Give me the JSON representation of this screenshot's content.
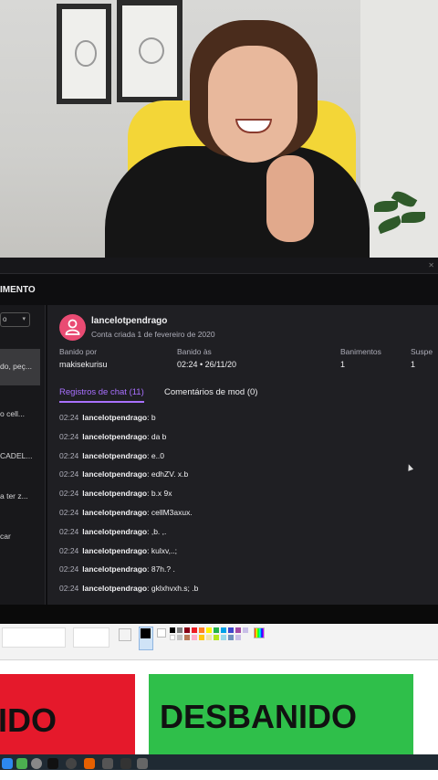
{
  "moderation": {
    "section_title": "IMENTO",
    "filter_value": "o",
    "sidebar_items": [
      "do, peç...",
      "o cell...",
      "CADEL...",
      "a ter z...",
      "car"
    ],
    "user": {
      "username": "lancelotpendrago",
      "account_created": "Conta criada 1 de fevereiro de 2020"
    },
    "stats": [
      {
        "label": "Banido por",
        "value": "makisekurisu"
      },
      {
        "label": "Banido às",
        "value": "02:24 • 26/11/20"
      },
      {
        "label": "Banimentos",
        "value": "1"
      },
      {
        "label": "Suspe",
        "value": "1"
      }
    ],
    "tabs": [
      "Registros de chat (11)",
      "Comentários de mod (0)"
    ],
    "chat": [
      {
        "time": "02:24",
        "user": "lancelotpendrago",
        "msg": ": b"
      },
      {
        "time": "02:24",
        "user": "lancelotpendrago",
        "msg": ": da b"
      },
      {
        "time": "02:24",
        "user": "lancelotpendrago",
        "msg": ": e..0"
      },
      {
        "time": "02:24",
        "user": "lancelotpendrago",
        "msg": ": edhZV. x.b"
      },
      {
        "time": "02:24",
        "user": "lancelotpendrago",
        "msg": ": b.x 9x"
      },
      {
        "time": "02:24",
        "user": "lancelotpendrago",
        "msg": ": cellM3axux."
      },
      {
        "time": "02:24",
        "user": "lancelotpendrago",
        "msg": ": ,b. ,."
      },
      {
        "time": "02:24",
        "user": "lancelotpendrago",
        "msg": ": kulxv,..;"
      },
      {
        "time": "02:24",
        "user": "lancelotpendrago",
        "msg": ": 87h.? ."
      },
      {
        "time": "02:24",
        "user": "lancelotpendrago",
        "msg": ": gklxhvxh.s; .b"
      }
    ]
  },
  "canvas": {
    "red_label": "IDO",
    "green_label": "DESBANIDO"
  },
  "colors": {
    "twitch_purple": "#a970ff",
    "avatar_pink": "#e94b73",
    "red_box": "#e5192b",
    "green_box": "#2fbf4a"
  },
  "icons": [
    "user-icon",
    "chevron-down-icon",
    "close-icon"
  ]
}
